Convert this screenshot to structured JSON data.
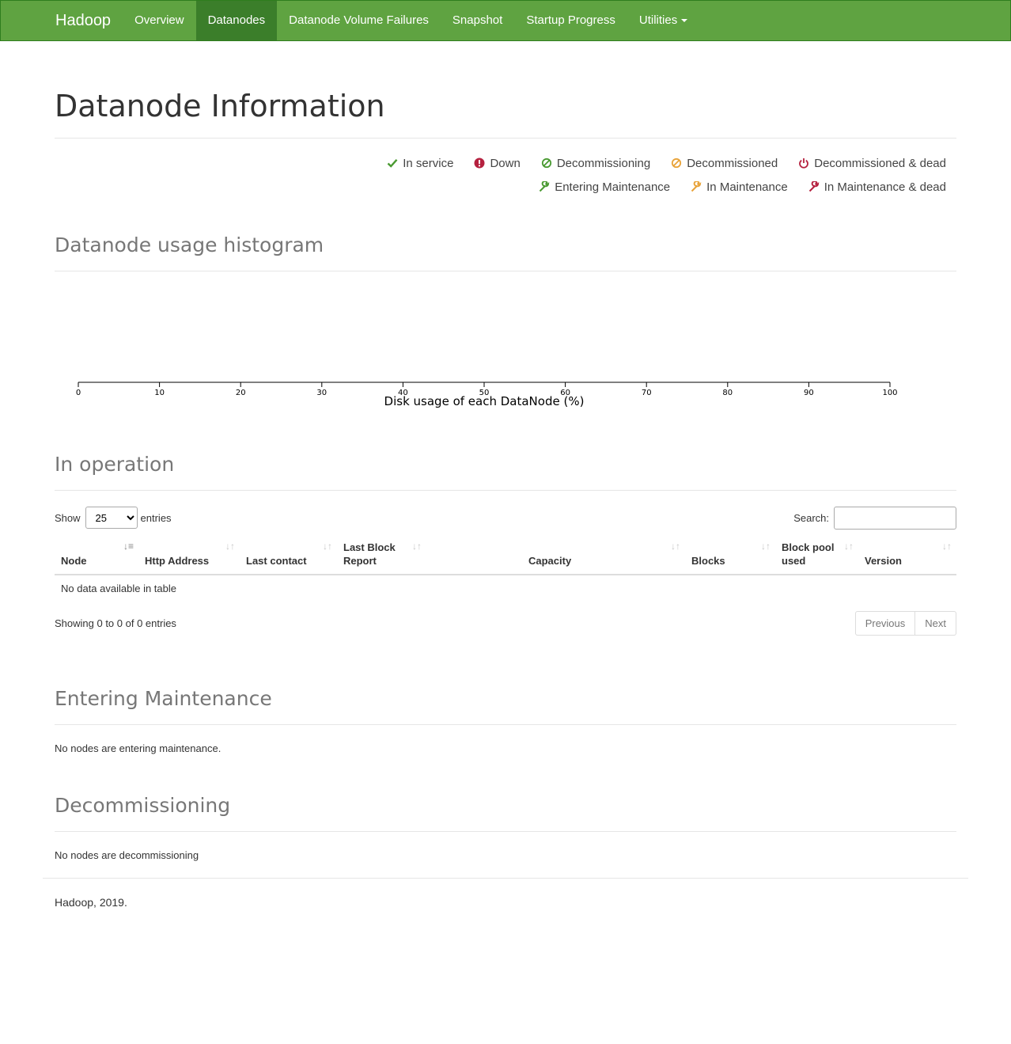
{
  "navbar": {
    "brand": "Hadoop",
    "items": [
      {
        "label": "Overview"
      },
      {
        "label": "Datanodes"
      },
      {
        "label": "Datanode Volume Failures"
      },
      {
        "label": "Snapshot"
      },
      {
        "label": "Startup Progress"
      },
      {
        "label": "Utilities"
      }
    ],
    "active_index": 1,
    "color": "#5fa341",
    "active_color": "#3b7e2a"
  },
  "page": {
    "title": "Datanode Information"
  },
  "legend": {
    "row1": [
      {
        "label": "In service",
        "icon": "check-icon",
        "color": "#4a9a32"
      },
      {
        "label": "Down",
        "icon": "exclamation-circle-icon",
        "color": "#b5213f"
      },
      {
        "label": "Decommissioning",
        "icon": "ban-icon",
        "color": "#4a9a32"
      },
      {
        "label": "Decommissioned",
        "icon": "ban-icon",
        "color": "#e8a33a"
      },
      {
        "label": "Decommissioned & dead",
        "icon": "power-off-icon",
        "color": "#b5213f"
      }
    ],
    "row2": [
      {
        "label": "Entering Maintenance",
        "icon": "wrench-icon",
        "color": "#4a9a32"
      },
      {
        "label": "In Maintenance",
        "icon": "wrench-icon",
        "color": "#e8a33a"
      },
      {
        "label": "In Maintenance & dead",
        "icon": "wrench-icon",
        "color": "#b5213f"
      }
    ]
  },
  "histogram": {
    "heading": "Datanode usage histogram",
    "chart_data": {
      "type": "bar",
      "x_ticks": [
        "0",
        "10",
        "20",
        "30",
        "40",
        "50",
        "60",
        "70",
        "80",
        "90",
        "100"
      ],
      "xlim": [
        0,
        100
      ],
      "xlabel": "Disk usage of each DataNode (%)",
      "values": []
    }
  },
  "in_operation": {
    "heading": "In operation",
    "show_label": "Show",
    "entries_label": "entries",
    "page_length": "25",
    "search_label": "Search:",
    "search_value": "",
    "columns": [
      {
        "label": "Node"
      },
      {
        "label": "Http Address"
      },
      {
        "label": "Last contact"
      },
      {
        "label": "Last Block Report"
      },
      {
        "label": "Capacity"
      },
      {
        "label": "Blocks"
      },
      {
        "label": "Block pool used"
      },
      {
        "label": "Version"
      }
    ],
    "empty_message": "No data available in table",
    "info": "Showing 0 to 0 of 0 entries",
    "prev_label": "Previous",
    "next_label": "Next"
  },
  "entering_maintenance": {
    "heading": "Entering Maintenance",
    "message": "No nodes are entering maintenance."
  },
  "decommissioning": {
    "heading": "Decommissioning",
    "message": "No nodes are decommissioning"
  },
  "footer": {
    "text": "Hadoop, 2019."
  }
}
